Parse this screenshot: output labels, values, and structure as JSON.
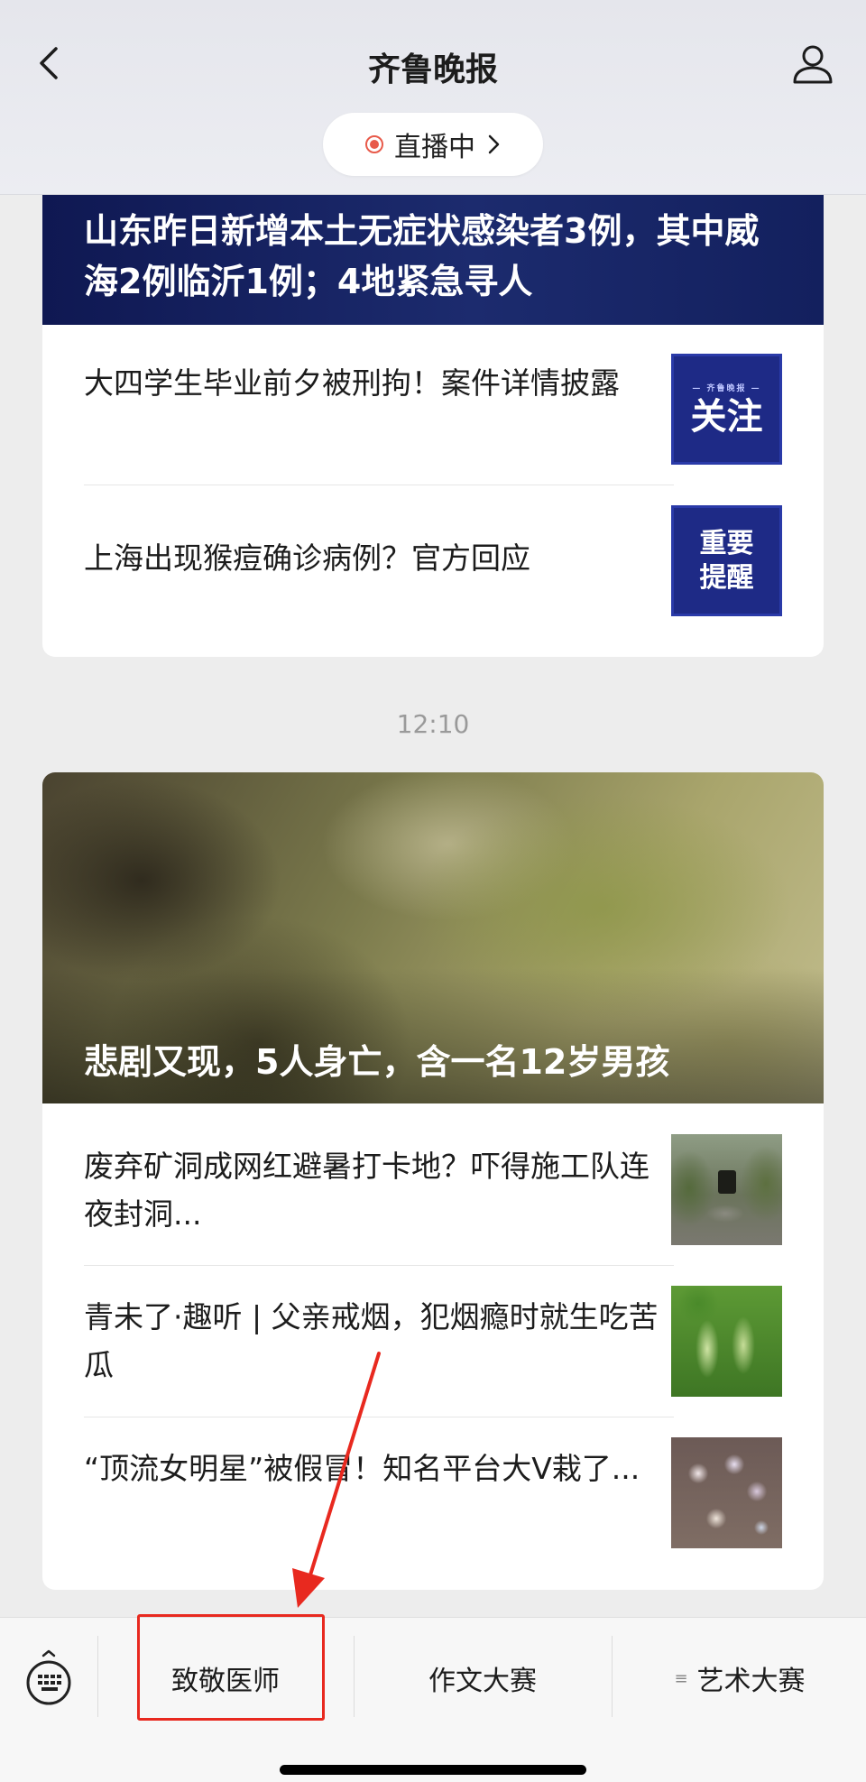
{
  "header": {
    "title": "齐鲁晚报",
    "live_label": "直播中"
  },
  "card1": {
    "banner_title": "山东昨日新增本土无症状感染者3例，其中威海2例临沂1例；4地紧急寻人",
    "items": [
      {
        "title": "大四学生毕业前夕被刑拘！案件详情披露",
        "thumb_top": "— 齐鲁晚报 —",
        "thumb_text": "关注"
      },
      {
        "title": "上海出现猴痘确诊病例？官方回应",
        "thumb_text": "重要提醒"
      }
    ]
  },
  "timestamp": "12:10",
  "card2": {
    "banner_title": "悲剧又现，5人身亡，含一名12岁男孩",
    "items": [
      {
        "title": "废弃矿洞成网红避暑打卡地？吓得施工队连夜封洞..."
      },
      {
        "title": "青未了·趣听 | 父亲戒烟，犯烟瘾时就生吃苦瓜"
      },
      {
        "title": "“顶流女明星”被假冒！知名平台大V栽了..."
      }
    ]
  },
  "menu": {
    "items": [
      "致敬医师",
      "作文大赛",
      "艺术大赛"
    ]
  },
  "colors": {
    "highlight_box": "#e8291f",
    "live_dot": "#e85a4a",
    "banner_navy": "#1c2b6e"
  }
}
